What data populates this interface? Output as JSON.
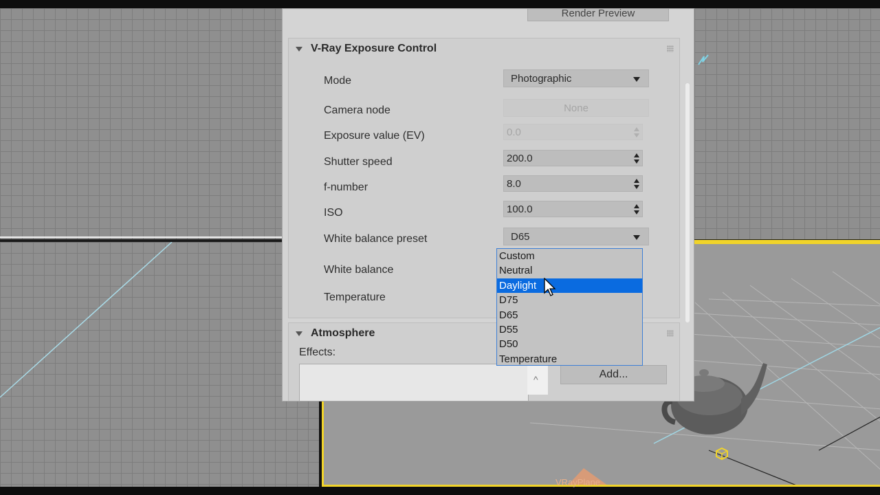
{
  "panel": {
    "render_preview_label": "Render Preview",
    "exposure_rollout": {
      "title": "V-Ray Exposure Control",
      "rows": {
        "mode": {
          "label": "Mode",
          "value": "Photographic"
        },
        "camera_node": {
          "label": "Camera node",
          "value": "None"
        },
        "exposure_value": {
          "label": "Exposure value (EV)",
          "value": "0.0"
        },
        "shutter_speed": {
          "label": "Shutter speed",
          "value": "200.0"
        },
        "f_number": {
          "label": "f-number",
          "value": "8.0"
        },
        "iso": {
          "label": "ISO",
          "value": "100.0"
        },
        "white_balance_preset": {
          "label": "White balance preset",
          "value": "D65"
        },
        "white_balance": {
          "label": "White balance"
        },
        "temperature": {
          "label": "Temperature"
        }
      }
    },
    "atmosphere_rollout": {
      "title": "Atmosphere",
      "effects_label": "Effects:",
      "add_button": "Add...",
      "scroll_up_glyph": "^"
    }
  },
  "white_balance_dropdown": {
    "options": [
      "Custom",
      "Neutral",
      "Daylight",
      "D75",
      "D65",
      "D55",
      "D50",
      "Temperature"
    ],
    "highlighted_index": 2
  },
  "viewport": {
    "object_label": "VRayPlane"
  },
  "colors": {
    "selection_blue": "#0a6be0",
    "viewport_active_border": "#f1d42a",
    "panel_bg": "#d4d4d4"
  }
}
